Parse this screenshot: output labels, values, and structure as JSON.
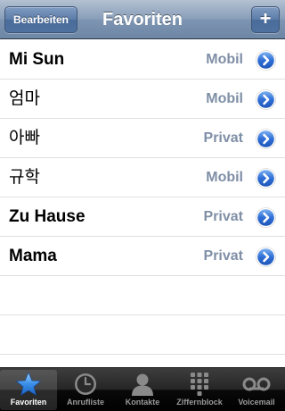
{
  "navbar": {
    "title": "Favoriten",
    "edit_label": "Bearbeiten",
    "add_label": "+"
  },
  "favorites": [
    {
      "name": "Mi Sun",
      "type": "Mobil",
      "bold": true
    },
    {
      "name": "엄마",
      "type": "Mobil",
      "bold": false
    },
    {
      "name": "아빠",
      "type": "Privat",
      "bold": false
    },
    {
      "name": "규학",
      "type": "Mobil",
      "bold": false
    },
    {
      "name": "Zu Hause",
      "type": "Privat",
      "bold": true
    },
    {
      "name": "Mama",
      "type": "Privat",
      "bold": true
    }
  ],
  "tabbar": {
    "tabs": [
      {
        "label": "Favoriten",
        "icon": "star-icon",
        "selected": true
      },
      {
        "label": "Anrufliste",
        "icon": "clock-icon",
        "selected": false
      },
      {
        "label": "Kontakte",
        "icon": "person-icon",
        "selected": false
      },
      {
        "label": "Ziffernblock",
        "icon": "keypad-icon",
        "selected": false
      },
      {
        "label": "Voicemail",
        "icon": "voicemail-icon",
        "selected": false
      }
    ]
  },
  "colors": {
    "accent_blue": "#2f6fd6",
    "detail_type_text": "#7f8fa6",
    "navbar": "#6d86a5"
  }
}
